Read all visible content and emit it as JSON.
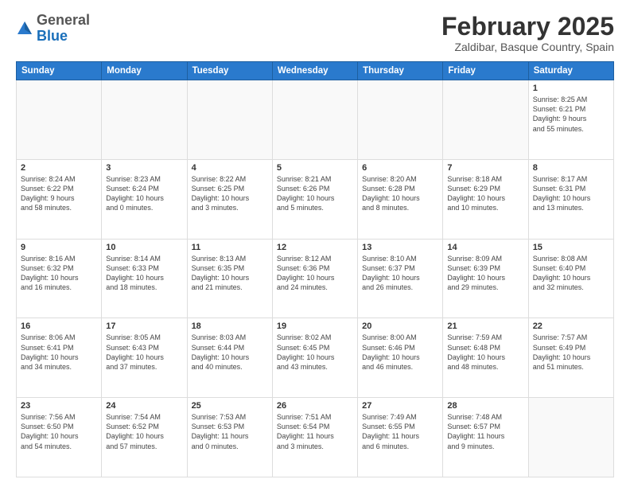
{
  "header": {
    "logo_general": "General",
    "logo_blue": "Blue",
    "month_title": "February 2025",
    "location": "Zaldibar, Basque Country, Spain"
  },
  "days_of_week": [
    "Sunday",
    "Monday",
    "Tuesday",
    "Wednesday",
    "Thursday",
    "Friday",
    "Saturday"
  ],
  "weeks": [
    [
      {
        "day": "",
        "info": ""
      },
      {
        "day": "",
        "info": ""
      },
      {
        "day": "",
        "info": ""
      },
      {
        "day": "",
        "info": ""
      },
      {
        "day": "",
        "info": ""
      },
      {
        "day": "",
        "info": ""
      },
      {
        "day": "1",
        "info": "Sunrise: 8:25 AM\nSunset: 6:21 PM\nDaylight: 9 hours\nand 55 minutes."
      }
    ],
    [
      {
        "day": "2",
        "info": "Sunrise: 8:24 AM\nSunset: 6:22 PM\nDaylight: 9 hours\nand 58 minutes."
      },
      {
        "day": "3",
        "info": "Sunrise: 8:23 AM\nSunset: 6:24 PM\nDaylight: 10 hours\nand 0 minutes."
      },
      {
        "day": "4",
        "info": "Sunrise: 8:22 AM\nSunset: 6:25 PM\nDaylight: 10 hours\nand 3 minutes."
      },
      {
        "day": "5",
        "info": "Sunrise: 8:21 AM\nSunset: 6:26 PM\nDaylight: 10 hours\nand 5 minutes."
      },
      {
        "day": "6",
        "info": "Sunrise: 8:20 AM\nSunset: 6:28 PM\nDaylight: 10 hours\nand 8 minutes."
      },
      {
        "day": "7",
        "info": "Sunrise: 8:18 AM\nSunset: 6:29 PM\nDaylight: 10 hours\nand 10 minutes."
      },
      {
        "day": "8",
        "info": "Sunrise: 8:17 AM\nSunset: 6:31 PM\nDaylight: 10 hours\nand 13 minutes."
      }
    ],
    [
      {
        "day": "9",
        "info": "Sunrise: 8:16 AM\nSunset: 6:32 PM\nDaylight: 10 hours\nand 16 minutes."
      },
      {
        "day": "10",
        "info": "Sunrise: 8:14 AM\nSunset: 6:33 PM\nDaylight: 10 hours\nand 18 minutes."
      },
      {
        "day": "11",
        "info": "Sunrise: 8:13 AM\nSunset: 6:35 PM\nDaylight: 10 hours\nand 21 minutes."
      },
      {
        "day": "12",
        "info": "Sunrise: 8:12 AM\nSunset: 6:36 PM\nDaylight: 10 hours\nand 24 minutes."
      },
      {
        "day": "13",
        "info": "Sunrise: 8:10 AM\nSunset: 6:37 PM\nDaylight: 10 hours\nand 26 minutes."
      },
      {
        "day": "14",
        "info": "Sunrise: 8:09 AM\nSunset: 6:39 PM\nDaylight: 10 hours\nand 29 minutes."
      },
      {
        "day": "15",
        "info": "Sunrise: 8:08 AM\nSunset: 6:40 PM\nDaylight: 10 hours\nand 32 minutes."
      }
    ],
    [
      {
        "day": "16",
        "info": "Sunrise: 8:06 AM\nSunset: 6:41 PM\nDaylight: 10 hours\nand 34 minutes."
      },
      {
        "day": "17",
        "info": "Sunrise: 8:05 AM\nSunset: 6:43 PM\nDaylight: 10 hours\nand 37 minutes."
      },
      {
        "day": "18",
        "info": "Sunrise: 8:03 AM\nSunset: 6:44 PM\nDaylight: 10 hours\nand 40 minutes."
      },
      {
        "day": "19",
        "info": "Sunrise: 8:02 AM\nSunset: 6:45 PM\nDaylight: 10 hours\nand 43 minutes."
      },
      {
        "day": "20",
        "info": "Sunrise: 8:00 AM\nSunset: 6:46 PM\nDaylight: 10 hours\nand 46 minutes."
      },
      {
        "day": "21",
        "info": "Sunrise: 7:59 AM\nSunset: 6:48 PM\nDaylight: 10 hours\nand 48 minutes."
      },
      {
        "day": "22",
        "info": "Sunrise: 7:57 AM\nSunset: 6:49 PM\nDaylight: 10 hours\nand 51 minutes."
      }
    ],
    [
      {
        "day": "23",
        "info": "Sunrise: 7:56 AM\nSunset: 6:50 PM\nDaylight: 10 hours\nand 54 minutes."
      },
      {
        "day": "24",
        "info": "Sunrise: 7:54 AM\nSunset: 6:52 PM\nDaylight: 10 hours\nand 57 minutes."
      },
      {
        "day": "25",
        "info": "Sunrise: 7:53 AM\nSunset: 6:53 PM\nDaylight: 11 hours\nand 0 minutes."
      },
      {
        "day": "26",
        "info": "Sunrise: 7:51 AM\nSunset: 6:54 PM\nDaylight: 11 hours\nand 3 minutes."
      },
      {
        "day": "27",
        "info": "Sunrise: 7:49 AM\nSunset: 6:55 PM\nDaylight: 11 hours\nand 6 minutes."
      },
      {
        "day": "28",
        "info": "Sunrise: 7:48 AM\nSunset: 6:57 PM\nDaylight: 11 hours\nand 9 minutes."
      },
      {
        "day": "",
        "info": ""
      }
    ]
  ]
}
